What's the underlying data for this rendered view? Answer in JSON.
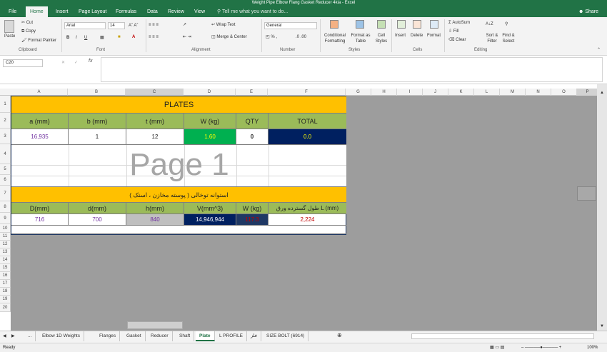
{
  "window": {
    "title": "Weight Pipe Elbow Flang Gasket Reducer 4kia - Excel"
  },
  "tabs": [
    {
      "label": "File"
    },
    {
      "label": "Home"
    },
    {
      "label": "Insert"
    },
    {
      "label": "Page Layout"
    },
    {
      "label": "Formulas"
    },
    {
      "label": "Data"
    },
    {
      "label": "Review"
    },
    {
      "label": "View"
    }
  ],
  "tell_me": "Tell me what you want to do...",
  "share": "Share",
  "ribbon": {
    "clipboard": {
      "paste": "Paste",
      "cut": "Cut",
      "copy": "Copy",
      "format_painter": "Format Painter",
      "label": "Clipboard"
    },
    "font": {
      "name": "Arial",
      "size": "14",
      "label": "Font"
    },
    "alignment": {
      "wrap": "Wrap Text",
      "merge": "Merge & Center",
      "label": "Alignment"
    },
    "number": {
      "format": "General",
      "label": "Number"
    },
    "styles": {
      "cond": "Conditional Formatting",
      "table": "Format as Table",
      "cell": "Cell Styles",
      "label": "Styles"
    },
    "cells": {
      "insert": "Insert",
      "delete": "Delete",
      "format": "Format",
      "label": "Cells"
    },
    "editing": {
      "autosum": "AutoSum",
      "fill": "Fill",
      "clear": "Clear",
      "sort": "Sort & Filter",
      "find": "Find & Select",
      "label": "Editing"
    }
  },
  "name_box": "C20",
  "fx": "fx",
  "columns": [
    "A",
    "B",
    "C",
    "D",
    "E",
    "F",
    "G",
    "H",
    "I",
    "J",
    "K",
    "L",
    "M",
    "N",
    "O",
    "P"
  ],
  "rows": [
    "1",
    "2",
    "3",
    "4",
    "5",
    "6",
    "7",
    "8",
    "9",
    "10",
    "11",
    "12",
    "13",
    "14",
    "15",
    "16",
    "17",
    "18",
    "19",
    "20"
  ],
  "sheet": {
    "title": "PLATES",
    "headers1": [
      "a (mm)",
      "b (mm)",
      "t (mm)",
      "W (kg)",
      "QTY",
      "TOTAL"
    ],
    "values1": [
      "16,935",
      "1",
      "12",
      "1.60",
      "0",
      "0.0"
    ],
    "watermark": "Page 1",
    "section2_title": "استوانه توخالی ( پوسته مخازن ، استک )",
    "headers2": [
      "D(mm)",
      "d(mm)",
      "h(mm)",
      "V(mm^3)",
      "W (kg)",
      "طول گسترده ورق  L  (mm)"
    ],
    "values2": [
      "716",
      "700",
      "840",
      "14,946,944",
      "117.3",
      "2,224"
    ]
  },
  "sheet_tabs": [
    "...",
    "Elbow 1D Weights",
    "Flanges",
    "Gasket",
    "Reducer",
    "Shaft",
    "Plate",
    "L PROFILE",
    "فلز",
    "SIZE BOLT (6914)"
  ],
  "active_sheet": "Plate",
  "status": {
    "ready": "Ready",
    "zoom": "100%"
  },
  "colors": {
    "brand": "#217346",
    "title_bg": "#ffc000",
    "header_bg": "#9bbb59",
    "navy": "#002060"
  }
}
